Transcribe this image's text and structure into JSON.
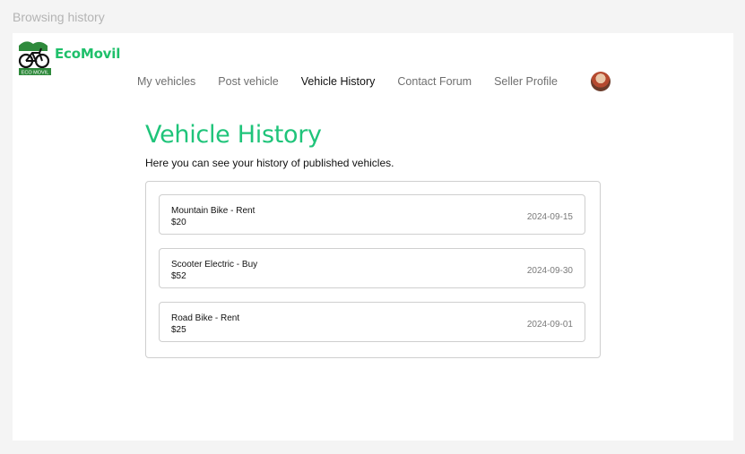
{
  "frame_label": "Browsing history",
  "brand": {
    "logo_text": "EcoMovil",
    "badge_text": "ECO MOVIL"
  },
  "nav": {
    "items": [
      "My vehicles",
      "Post vehicle",
      "Vehicle History",
      "Contact Forum",
      "Seller Profile"
    ],
    "active": "Vehicle History"
  },
  "page": {
    "title": "Vehicle History",
    "subtitle": "Here you can see your history of published vehicles."
  },
  "history": [
    {
      "name": "Mountain Bike - Rent",
      "price": "$20",
      "date": "2024-09-15"
    },
    {
      "name": "Scooter Electric - Buy",
      "price": "$52",
      "date": "2024-09-30"
    },
    {
      "name": "Road Bike -  Rent",
      "price": "$25",
      "date": "2024-09-01"
    }
  ],
  "colors": {
    "accent": "#1fc47a",
    "border": "#cfcfcf",
    "text": "#111111",
    "muted": "#7a7a7a"
  }
}
